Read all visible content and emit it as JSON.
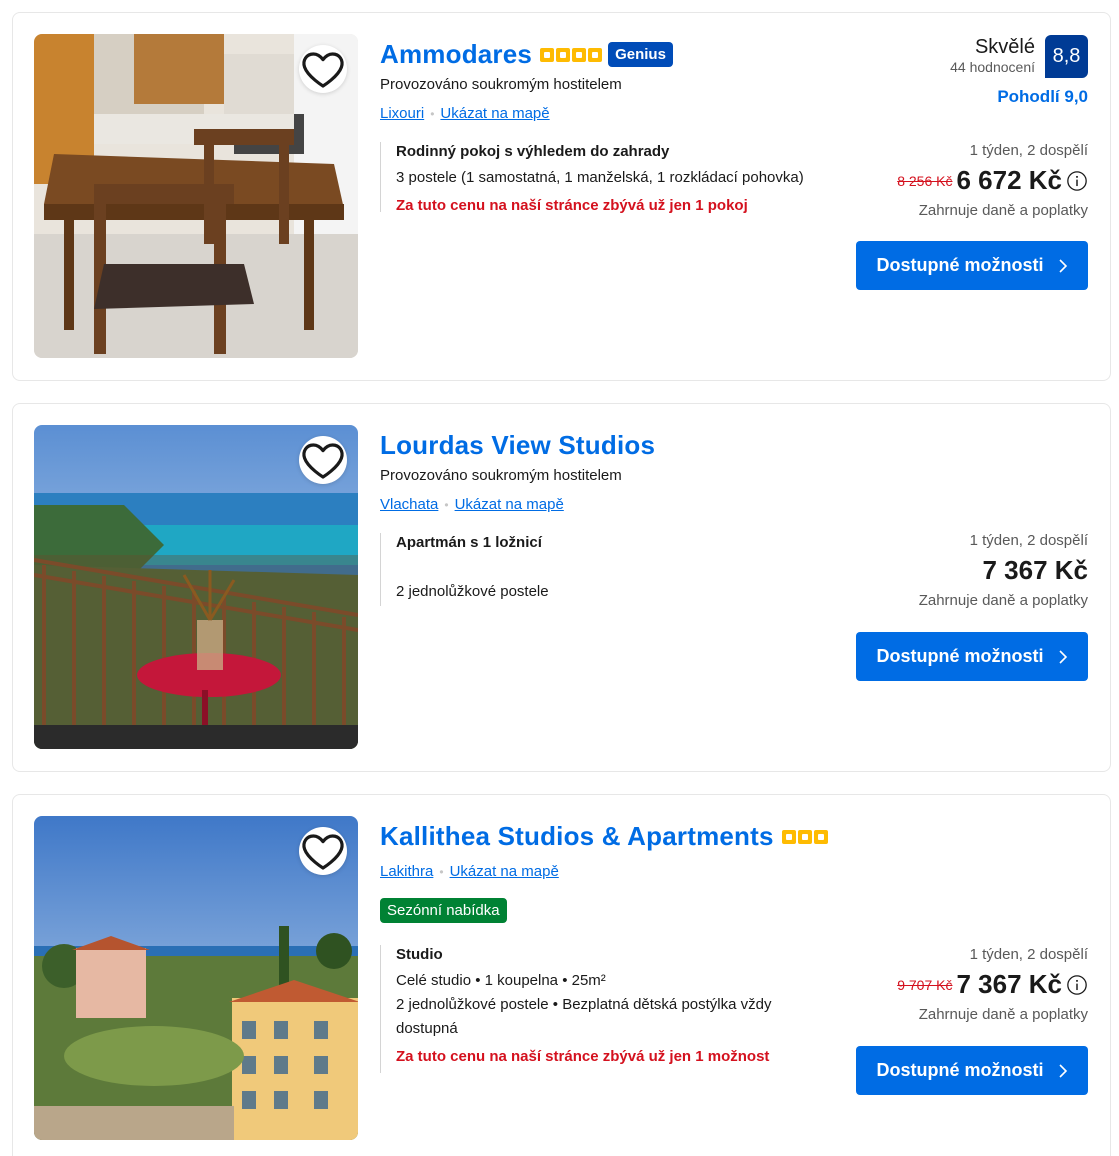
{
  "listings": [
    {
      "name": "Ammodares",
      "star_count": 4,
      "genius": "Genius",
      "host": "Provozováno soukromým hostitelem",
      "location": "Lixouri",
      "map_link": "Ukázat na mapě",
      "room_name": "Rodinný pokoj s výhledem do zahrady",
      "room_details": [
        "3 postele (1 samostatná, 1 manželská, 1 rozkládací pohovka)"
      ],
      "urgency": "Za tuto cenu na naší stránce zbývá už jen 1 pokoj",
      "score_word": "Skvělé",
      "review_count": "44 hodnocení",
      "score": "8,8",
      "location_score": "Pohodlí 9,0",
      "guests": "1 týden, 2 dospělí",
      "old_price": "8 256 Kč",
      "price": "6 672 Kč",
      "taxes": "Zahrnuje daně a poplatky",
      "cta": "Dostupné možnosti"
    },
    {
      "name": "Lourdas View Studios",
      "host": "Provozováno soukromým hostitelem",
      "location": "Vlachata",
      "map_link": "Ukázat na mapě",
      "room_name": "Apartmán s 1 ložnicí",
      "room_details": [
        "2 jednolůžkové postele"
      ],
      "guests": "1 týden, 2 dospělí",
      "price": "7 367 Kč",
      "taxes": "Zahrnuje daně a poplatky",
      "cta": "Dostupné možnosti"
    },
    {
      "name": "Kallithea Studios & Apartments",
      "star_count": 3,
      "location": "Lakithra",
      "map_link": "Ukázat na mapě",
      "badge": "Sezónní nabídka",
      "room_name": "Studio",
      "room_details": [
        "Celé studio • 1 koupelna • 25m²",
        "2 jednolůžkové postele • Bezplatná dětská postýlka vždy dostupná"
      ],
      "urgency": "Za tuto cenu na naší stránce zbývá už jen 1 možnost",
      "guests": "1 týden, 2 dospělí",
      "old_price": "9 707 Kč",
      "price": "7 367 Kč",
      "taxes": "Zahrnuje daně a poplatky",
      "cta": "Dostupné možnosti"
    }
  ],
  "colors": {
    "brand_blue": "#006ce4",
    "score_blue": "#003b95",
    "genius_blue": "#004cb8",
    "star_yellow": "#febb02",
    "urgent_red": "#d4111e",
    "badge_green": "#008234"
  },
  "icons": [
    "heart-icon",
    "info-icon",
    "chevron-right-icon"
  ]
}
